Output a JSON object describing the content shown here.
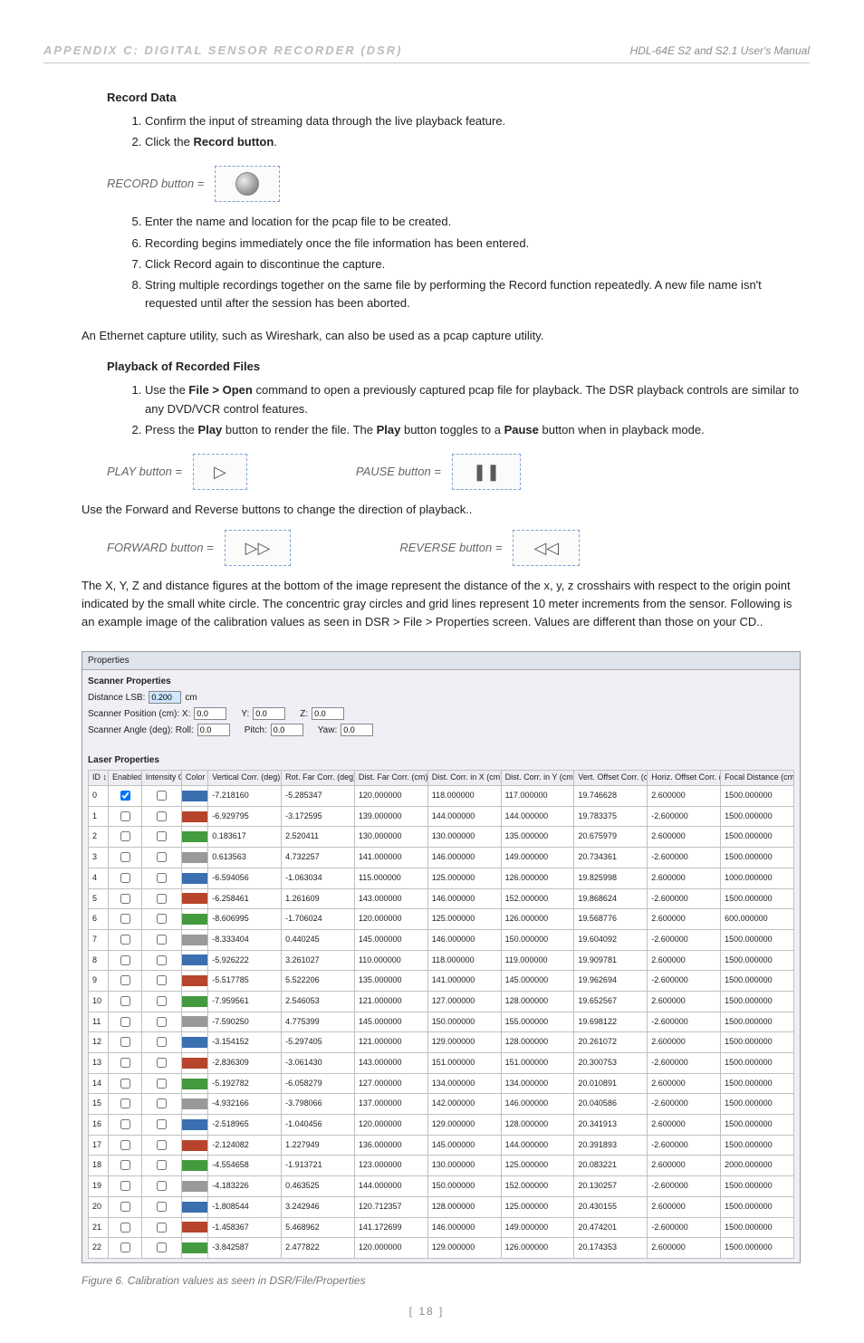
{
  "header": {
    "appendix": "Appendix C: Digital Sensor Recorder (DSR)",
    "manual": "HDL-64E S2 and S2.1 User's Manual"
  },
  "record": {
    "heading": "Record Data",
    "step1": "Confirm the input of streaming data through the live playback feature.",
    "step2_pre": "Click the ",
    "step2_strong": "Record button",
    "step2_post": ".",
    "btn_label": "RECORD button =",
    "step5": "Enter the name and location for the pcap file to be created.",
    "step6": "Recording begins immediately once the file information has been entered.",
    "step7": "Click Record again to discontinue the capture.",
    "step8": "String multiple recordings together on the same file by performing the Record function repeatedly. A new file name isn't requested until after the session has been aborted."
  },
  "ethernet_note": "An Ethernet capture utility, such as Wireshark, can also be used as a pcap capture utility.",
  "playback": {
    "heading": "Playback of Recorded Files",
    "step1_pre": "Use the ",
    "step1_strong": "File > Open",
    "step1_post": " command to open a previously captured pcap file for playback. The DSR playback controls are similar to any DVD/VCR control features.",
    "step2_pre": "Press the ",
    "step2_strong1": "Play",
    "step2_mid": " button to render the file. The ",
    "step2_strong2": "Play",
    "step2_mid2": " button toggles to a ",
    "step2_strong3": "Pause",
    "step2_post": " button when in playback mode.",
    "play_label": "PLAY button =",
    "pause_label": "PAUSE button =",
    "use_fwd_rev": "Use the Forward and Reverse buttons to change the direction of playback..",
    "forward_label": "FORWARD button =",
    "reverse_label": "REVERSE button ="
  },
  "xyz_para": "The X, Y, Z and distance figures at the bottom of the image represent the distance of the x, y, z crosshairs with respect to the origin point indicated by the small white circle. The concentric gray circles and grid lines represent 10 meter increments from the sensor. Following is an example image of the calibration values as seen in DSR > File > Properties screen. Values are different than those on your CD..",
  "panel": {
    "title": "Properties",
    "scanner_h": "Scanner Properties",
    "distance_lsb_label": "Distance LSB:",
    "distance_lsb_val": "0.200",
    "distance_lsb_unit": "cm",
    "pos_label_pre": "Scanner Position (cm):  X:",
    "pos_x": "0.0",
    "pos_y_l": "Y:",
    "pos_y": "0.0",
    "pos_z_l": "Z:",
    "pos_z": "0.0",
    "ang_label_pre": "Scanner Angle (deg):  Roll:",
    "ang_r": "0.0",
    "ang_p_l": "Pitch:",
    "ang_p": "0.0",
    "ang_y_l": "Yaw:",
    "ang_y": "0.0",
    "laser_h": "Laser Properties",
    "cols": [
      "ID ↕",
      "Enabled",
      "Intensity On",
      "Color",
      "Vertical Corr. (deg) ↕",
      "Rot. Far Corr. (deg) ↕",
      "Dist. Far Corr. (cm) ↕",
      "Dist. Corr. in X (cm) ↕",
      "Dist. Corr. in Y (cm) ↕",
      "Vert. Offset Corr. (cm) ↕",
      "Horiz. Offset Corr. (cm) ↕",
      "Focal Distance (cm) ↕"
    ]
  },
  "rows": [
    {
      "id": "0",
      "en": true,
      "io": false,
      "c": "#3a6fb0",
      "vc": "-7.218160",
      "rf": "-5.285347",
      "df": "120.000000",
      "dx": "118.000000",
      "dy": "117.000000",
      "vo": "19.746628",
      "ho": "2.600000",
      "fd": "1500.000000"
    },
    {
      "id": "1",
      "en": false,
      "io": false,
      "c": "#b7442c",
      "vc": "-6.929795",
      "rf": "-3.172595",
      "df": "139.000000",
      "dx": "144.000000",
      "dy": "144.000000",
      "vo": "19.783375",
      "ho": "-2.600000",
      "fd": "1500.000000"
    },
    {
      "id": "2",
      "en": false,
      "io": false,
      "c": "#449a3f",
      "vc": "0.183617",
      "rf": "2.520411",
      "df": "130.000000",
      "dx": "130.000000",
      "dy": "135.000000",
      "vo": "20.675979",
      "ho": "2.600000",
      "fd": "1500.000000"
    },
    {
      "id": "3",
      "en": false,
      "io": false,
      "c": "#999999",
      "vc": "0.613563",
      "rf": "4.732257",
      "df": "141.000000",
      "dx": "146.000000",
      "dy": "149.000000",
      "vo": "20.734361",
      "ho": "-2.600000",
      "fd": "1500.000000"
    },
    {
      "id": "4",
      "en": false,
      "io": false,
      "c": "#3a6fb0",
      "vc": "-6.594056",
      "rf": "-1.063034",
      "df": "115.000000",
      "dx": "125.000000",
      "dy": "126.000000",
      "vo": "19.825998",
      "ho": "2.600000",
      "fd": "1000.000000"
    },
    {
      "id": "5",
      "en": false,
      "io": false,
      "c": "#b7442c",
      "vc": "-6.258461",
      "rf": "1.261609",
      "df": "143.000000",
      "dx": "146.000000",
      "dy": "152.000000",
      "vo": "19.868624",
      "ho": "-2.600000",
      "fd": "1500.000000"
    },
    {
      "id": "6",
      "en": false,
      "io": false,
      "c": "#449a3f",
      "vc": "-8.606995",
      "rf": "-1.706024",
      "df": "120.000000",
      "dx": "125.000000",
      "dy": "126.000000",
      "vo": "19.568776",
      "ho": "2.600000",
      "fd": "600.000000"
    },
    {
      "id": "7",
      "en": false,
      "io": false,
      "c": "#999999",
      "vc": "-8.333404",
      "rf": "0.440245",
      "df": "145.000000",
      "dx": "146.000000",
      "dy": "150.000000",
      "vo": "19.604092",
      "ho": "-2.600000",
      "fd": "1500.000000"
    },
    {
      "id": "8",
      "en": false,
      "io": false,
      "c": "#3a6fb0",
      "vc": "-5.926222",
      "rf": "3.261027",
      "df": "110.000000",
      "dx": "118.000000",
      "dy": "119.000000",
      "vo": "19.909781",
      "ho": "2.600000",
      "fd": "1500.000000"
    },
    {
      "id": "9",
      "en": false,
      "io": false,
      "c": "#b7442c",
      "vc": "-5.517785",
      "rf": "5.522206",
      "df": "135.000000",
      "dx": "141.000000",
      "dy": "145.000000",
      "vo": "19.962694",
      "ho": "-2.600000",
      "fd": "1500.000000"
    },
    {
      "id": "10",
      "en": false,
      "io": false,
      "c": "#449a3f",
      "vc": "-7.959561",
      "rf": "2.546053",
      "df": "121.000000",
      "dx": "127.000000",
      "dy": "128.000000",
      "vo": "19.652567",
      "ho": "2.600000",
      "fd": "1500.000000"
    },
    {
      "id": "11",
      "en": false,
      "io": false,
      "c": "#999999",
      "vc": "-7.590250",
      "rf": "4.775399",
      "df": "145.000000",
      "dx": "150.000000",
      "dy": "155.000000",
      "vo": "19.698122",
      "ho": "-2.600000",
      "fd": "1500.000000"
    },
    {
      "id": "12",
      "en": false,
      "io": false,
      "c": "#3a6fb0",
      "vc": "-3.154152",
      "rf": "-5.297405",
      "df": "121.000000",
      "dx": "129.000000",
      "dy": "128.000000",
      "vo": "20.261072",
      "ho": "2.600000",
      "fd": "1500.000000"
    },
    {
      "id": "13",
      "en": false,
      "io": false,
      "c": "#b7442c",
      "vc": "-2.836309",
      "rf": "-3.061430",
      "df": "143.000000",
      "dx": "151.000000",
      "dy": "151.000000",
      "vo": "20.300753",
      "ho": "-2.600000",
      "fd": "1500.000000"
    },
    {
      "id": "14",
      "en": false,
      "io": false,
      "c": "#449a3f",
      "vc": "-5.192782",
      "rf": "-6.058279",
      "df": "127.000000",
      "dx": "134.000000",
      "dy": "134.000000",
      "vo": "20.010891",
      "ho": "2.600000",
      "fd": "1500.000000"
    },
    {
      "id": "15",
      "en": false,
      "io": false,
      "c": "#999999",
      "vc": "-4.932166",
      "rf": "-3.798066",
      "df": "137.000000",
      "dx": "142.000000",
      "dy": "146.000000",
      "vo": "20.040586",
      "ho": "-2.600000",
      "fd": "1500.000000"
    },
    {
      "id": "16",
      "en": false,
      "io": false,
      "c": "#3a6fb0",
      "vc": "-2.518965",
      "rf": "-1.040456",
      "df": "120.000000",
      "dx": "129.000000",
      "dy": "128.000000",
      "vo": "20.341913",
      "ho": "2.600000",
      "fd": "1500.000000"
    },
    {
      "id": "17",
      "en": false,
      "io": false,
      "c": "#b7442c",
      "vc": "-2.124082",
      "rf": "1.227949",
      "df": "136.000000",
      "dx": "145.000000",
      "dy": "144.000000",
      "vo": "20.391893",
      "ho": "-2.600000",
      "fd": "1500.000000"
    },
    {
      "id": "18",
      "en": false,
      "io": false,
      "c": "#449a3f",
      "vc": "-4.554658",
      "rf": "-1.913721",
      "df": "123.000000",
      "dx": "130.000000",
      "dy": "125.000000",
      "vo": "20.083221",
      "ho": "2.600000",
      "fd": "2000.000000"
    },
    {
      "id": "19",
      "en": false,
      "io": false,
      "c": "#999999",
      "vc": "-4.183226",
      "rf": "0.463525",
      "df": "144.000000",
      "dx": "150.000000",
      "dy": "152.000000",
      "vo": "20.130257",
      "ho": "-2.600000",
      "fd": "1500.000000"
    },
    {
      "id": "20",
      "en": false,
      "io": false,
      "c": "#3a6fb0",
      "vc": "-1.808544",
      "rf": "3.242946",
      "df": "120.712357",
      "dx": "128.000000",
      "dy": "125.000000",
      "vo": "20.430155",
      "ho": "2.600000",
      "fd": "1500.000000"
    },
    {
      "id": "21",
      "en": false,
      "io": false,
      "c": "#b7442c",
      "vc": "-1.458367",
      "rf": "5.468962",
      "df": "141.172699",
      "dx": "146.000000",
      "dy": "149.000000",
      "vo": "20.474201",
      "ho": "-2.600000",
      "fd": "1500.000000"
    },
    {
      "id": "22",
      "en": false,
      "io": false,
      "c": "#449a3f",
      "vc": "-3.842587",
      "rf": "2.477822",
      "df": "120.000000",
      "dx": "129.000000",
      "dy": "126.000000",
      "vo": "20.174353",
      "ho": "2.600000",
      "fd": "1500.000000"
    }
  ],
  "figcap": "Figure 6. Calibration values as seen in DSR/File/Properties",
  "pagenum": "[ 18 ]"
}
